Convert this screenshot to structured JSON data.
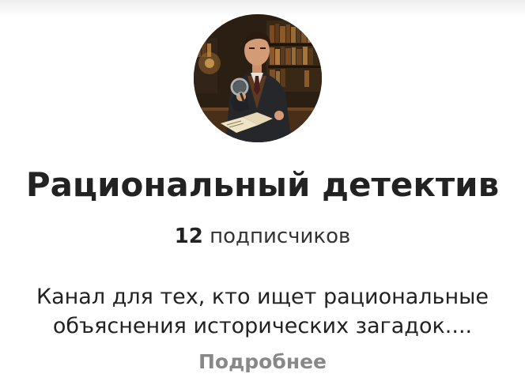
{
  "channel": {
    "title": "Рациональный детектив",
    "subscribers_count": "12",
    "subscribers_label": "подписчиков",
    "description_line1": "Канал для тех, кто ищет рациональные",
    "description_line2": "объяснения исторических загадок....",
    "more_link": "Подробнее",
    "avatar_icon": "detective-portrait-avatar"
  }
}
